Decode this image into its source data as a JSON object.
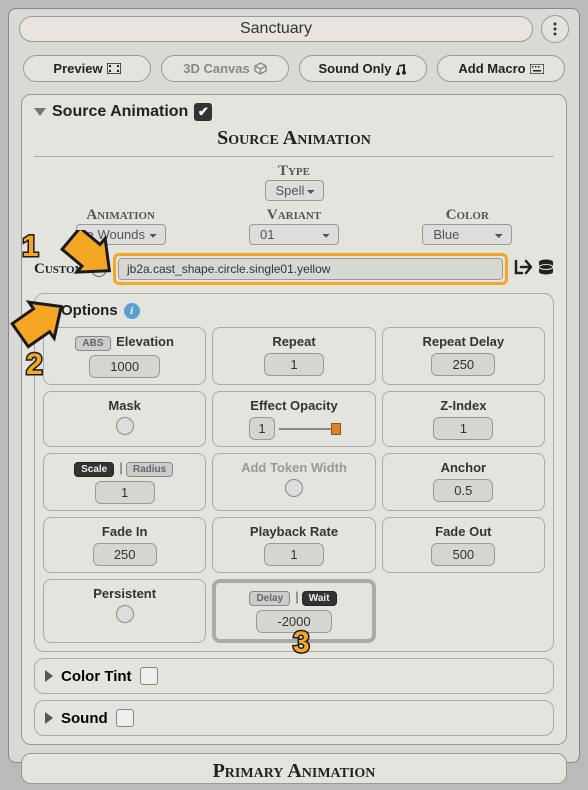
{
  "window": {
    "title": "Sanctuary"
  },
  "tabs": {
    "preview": "Preview",
    "canvas": "3D Canvas",
    "sound": "Sound Only",
    "macro": "Add Macro"
  },
  "source": {
    "header": "Source Animation",
    "title": "Source Animation",
    "type_label": "Type",
    "type_value": "Spell",
    "animation_label": "Animation",
    "animation_value": "e Wounds",
    "variant_label": "Variant",
    "variant_value": "01",
    "color_label": "Color",
    "color_value": "Blue",
    "custom_label": "Custom",
    "custom_path": "jb2a.cast_shape.circle.single01.yellow"
  },
  "options": {
    "header": "Options",
    "elevation": {
      "badge": "ABS",
      "label": "Elevation",
      "value": "1000"
    },
    "repeat": {
      "label": "Repeat",
      "value": "1"
    },
    "repeat_delay": {
      "label": "Repeat Delay",
      "value": "250"
    },
    "mask": {
      "label": "Mask"
    },
    "opacity": {
      "label": "Effect Opacity",
      "value": "1"
    },
    "zindex": {
      "label": "Z-Index",
      "value": "1"
    },
    "scale": {
      "btn1": "Scale",
      "btn2": "Radius",
      "value": "1"
    },
    "token_width": {
      "label": "Add Token Width"
    },
    "anchor": {
      "label": "Anchor",
      "value": "0.5"
    },
    "fade_in": {
      "label": "Fade In",
      "value": "250"
    },
    "playback": {
      "label": "Playback Rate",
      "value": "1"
    },
    "fade_out": {
      "label": "Fade Out",
      "value": "500"
    },
    "persistent": {
      "label": "Persistent"
    },
    "delay_wait": {
      "btn1": "Delay",
      "btn2": "Wait",
      "value": "-2000"
    }
  },
  "color_tint": {
    "label": "Color Tint"
  },
  "sound": {
    "label": "Sound"
  },
  "primary": {
    "title": "Primary Animation"
  },
  "tutorial": {
    "n1": "1",
    "n2": "2",
    "n3": "3"
  }
}
